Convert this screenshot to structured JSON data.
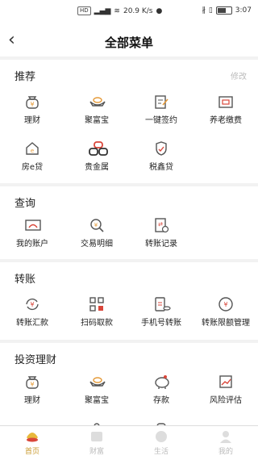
{
  "status": {
    "center_badge": "HD",
    "center_speed": "20.9 K/s",
    "time": "3:07"
  },
  "header": {
    "title": "全部菜单"
  },
  "sections": [
    {
      "title": "推荐",
      "edit": "修改",
      "items": [
        "理财",
        "聚富宝",
        "一键签约",
        "养老缴费",
        "房e贷",
        "贵金属",
        "税鑫贷"
      ]
    },
    {
      "title": "查询",
      "items": [
        "我的账户",
        "交易明细",
        "转账记录"
      ]
    },
    {
      "title": "转账",
      "items": [
        "转账汇款",
        "扫码取款",
        "手机号转账",
        "转账限额管理"
      ]
    },
    {
      "title": "投资理财",
      "items": [
        "理财",
        "聚富宝",
        "存款",
        "风险评估"
      ]
    }
  ],
  "tabs": [
    "首页",
    "财富",
    "生活",
    "我的"
  ],
  "colors": {
    "accent": "#c99a2e",
    "icon": "#555",
    "red": "#d9463a",
    "orange": "#e59b3a"
  }
}
